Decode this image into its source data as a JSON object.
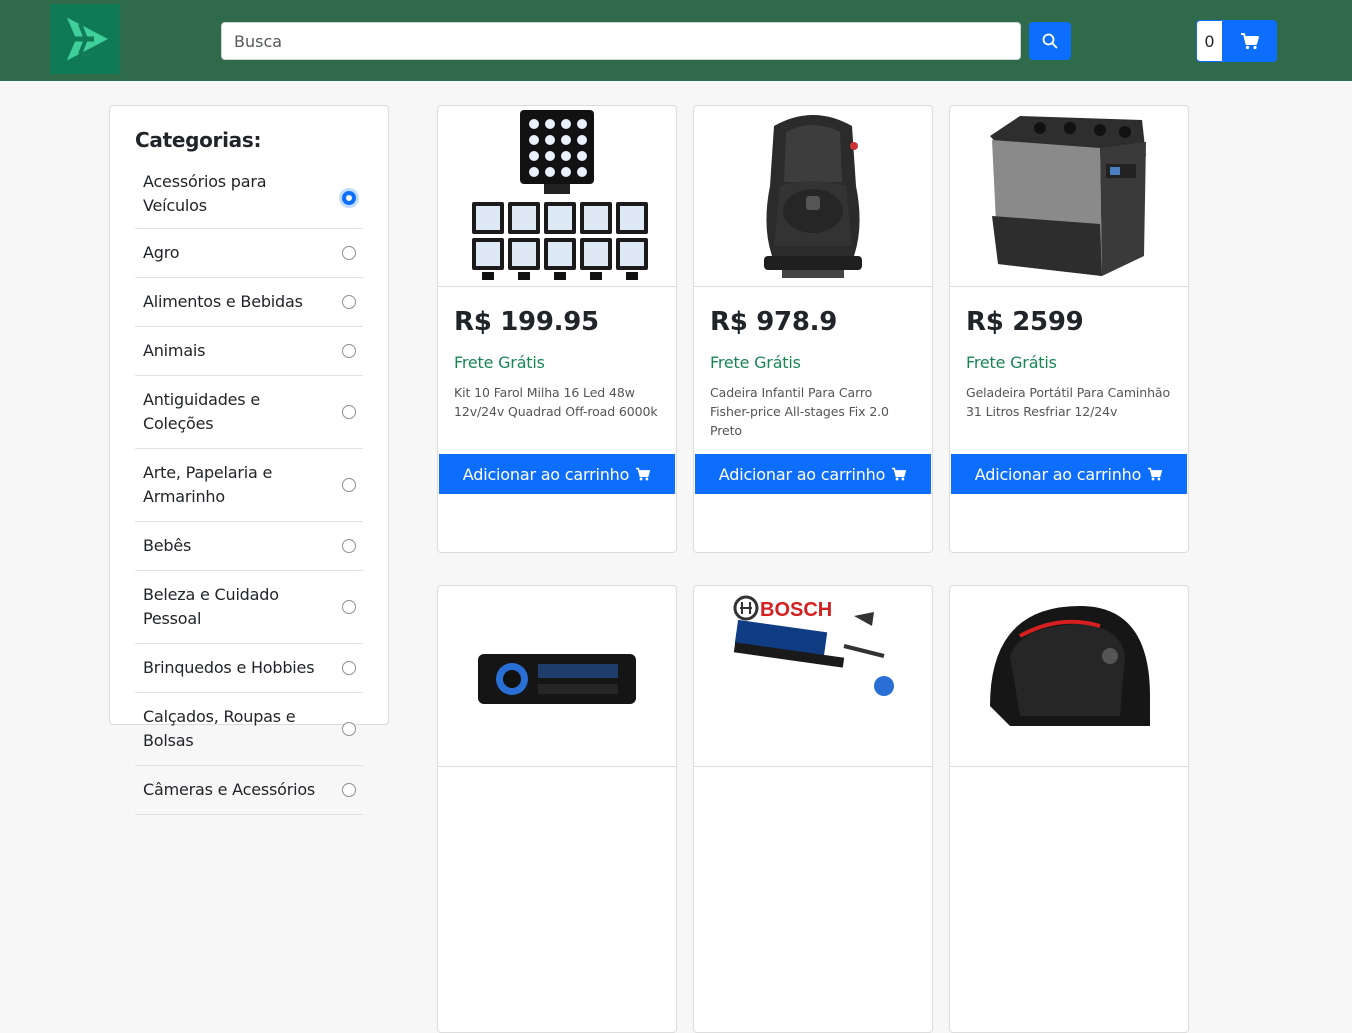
{
  "header": {
    "logo_icon": "plane-logo-icon",
    "search": {
      "placeholder": "Busca",
      "value": ""
    },
    "search_button_icon": "search-icon",
    "cart": {
      "count": "0",
      "icon": "shopping-cart-icon"
    },
    "colors": {
      "bar": "#2f6b4a",
      "logo": "#0f7a55",
      "primary": "#0d6efd"
    }
  },
  "sidebar": {
    "title": "Categorias:",
    "categories": [
      {
        "label": "Acessórios para Veículos",
        "checked": true
      },
      {
        "label": "Agro",
        "checked": false
      },
      {
        "label": "Alimentos e Bebidas",
        "checked": false
      },
      {
        "label": "Animais",
        "checked": false
      },
      {
        "label": "Antiguidades e Coleções",
        "checked": false
      },
      {
        "label": "Arte, Papelaria e Armarinho",
        "checked": false
      },
      {
        "label": "Bebês",
        "checked": false
      },
      {
        "label": "Beleza e Cuidado Pessoal",
        "checked": false
      },
      {
        "label": "Brinquedos e Hobbies",
        "checked": false
      },
      {
        "label": "Calçados, Roupas e Bolsas",
        "checked": false
      },
      {
        "label": "Câmeras e Acessórios",
        "checked": false
      }
    ]
  },
  "products": [
    {
      "price": "R$ 199.95",
      "shipping": "Frete Grátis",
      "title": "Kit 10 Farol Milha 16 Led 48w 12v/24v Quadrad Off-road 6000k",
      "button": "Adicionar ao carrinho",
      "image": "led-work-lights-kit"
    },
    {
      "price": "R$ 978.9",
      "shipping": "Frete Grátis",
      "title": "Cadeira Infantil Para Carro Fisher-price All-stages Fix 2.0 Preto",
      "button": "Adicionar ao carrinho",
      "image": "child-car-seat"
    },
    {
      "price": "R$ 2599",
      "shipping": "Frete Grátis",
      "title": "Geladeira Portátil Para Caminhão 31 Litros Resfriar 12/24v",
      "button": "Adicionar ao carrinho",
      "image": "portable-fridge"
    },
    {
      "image": "car-stereo"
    },
    {
      "image": "bosch-wiper-blades",
      "brand_text": "BOSCH"
    },
    {
      "image": "motorcycle-helmet"
    }
  ]
}
